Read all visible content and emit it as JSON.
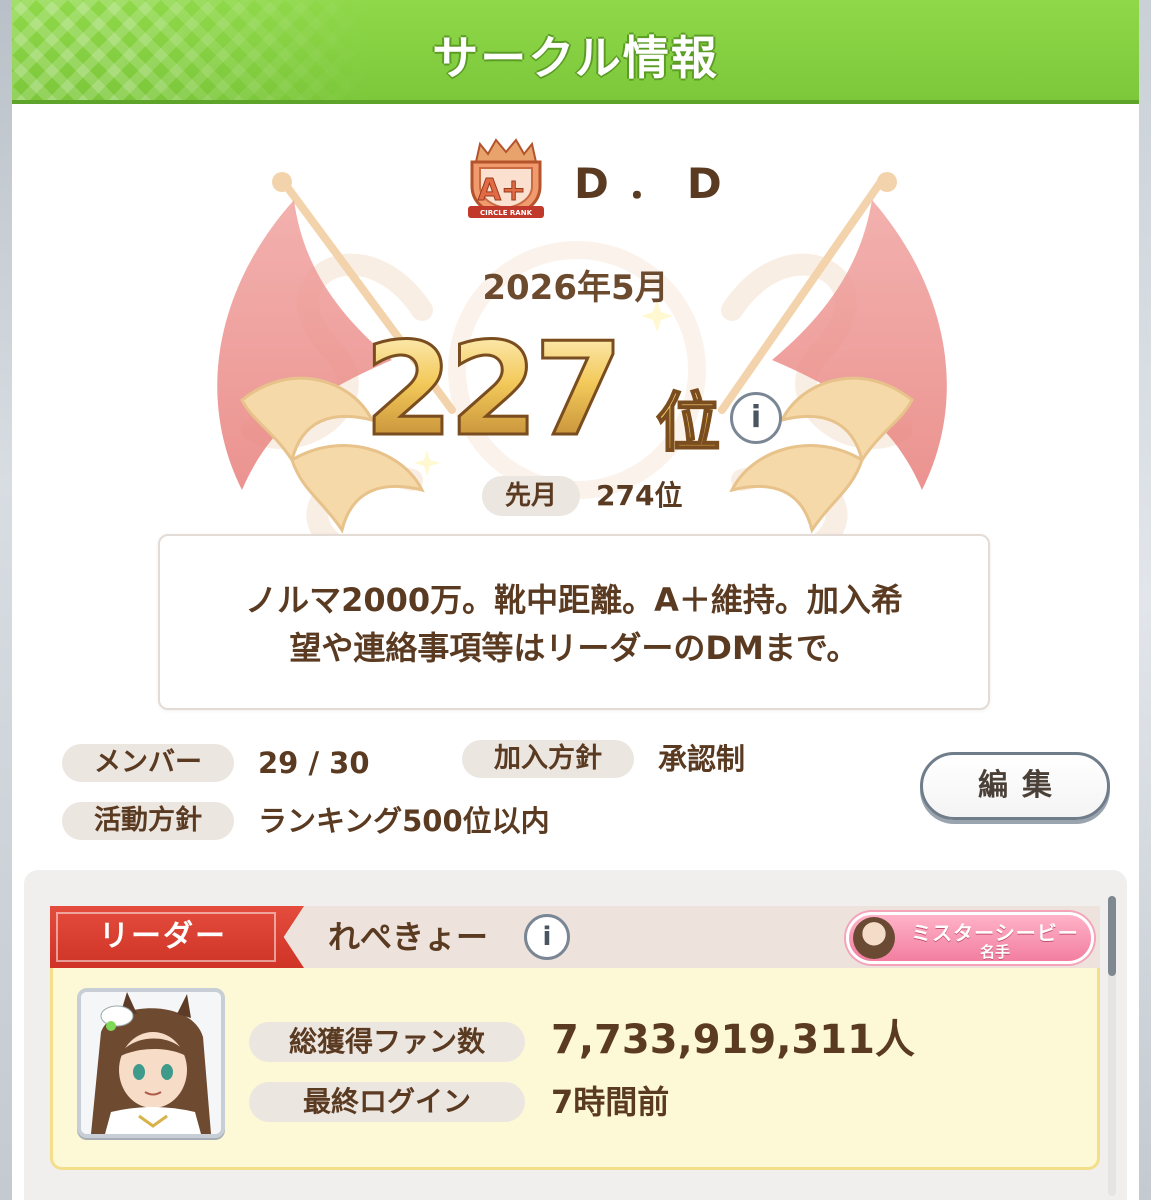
{
  "header": {
    "title": "サークル情報"
  },
  "circle": {
    "rank_badge": {
      "grade": "A+",
      "caption": "CIRCLE RANK"
    },
    "name": "D．D",
    "month": "2026年5月",
    "rank_number": "227",
    "rank_unit": "位",
    "last_month_label": "先月",
    "last_month_value": "274位",
    "description_line1": "ノルマ2000万。靴中距離。A＋維持。加入希",
    "description_line2": "望や連絡事項等はリーダーのDMまで。"
  },
  "info": {
    "members_label": "メンバー",
    "members_value": "29 / 30",
    "join_policy_label": "加入方針",
    "join_policy_value": "承認制",
    "activity_policy_label": "活動方針",
    "activity_policy_value": "ランキング500位以内",
    "edit_button_label": "編集"
  },
  "leader": {
    "tag_label": "リーダー",
    "name": "れぺきょー",
    "title_line1": "ミスターシービー",
    "title_line2": "名手",
    "fans_label": "総獲得ファン数",
    "fans_value": "7,733,919,311",
    "fans_unit": "人",
    "last_login_label": "最終ログイン",
    "last_login_value": "7時間前"
  },
  "colors": {
    "header_green": "#7cc83a",
    "text_brown": "#5a3b22",
    "leader_red": "#d9392b",
    "title_pink": "#f27ea0",
    "card_yellow": "#fdf8d6"
  },
  "icons": {
    "info_button": "info-icon",
    "rank_badge": "crown-shield-icon"
  }
}
